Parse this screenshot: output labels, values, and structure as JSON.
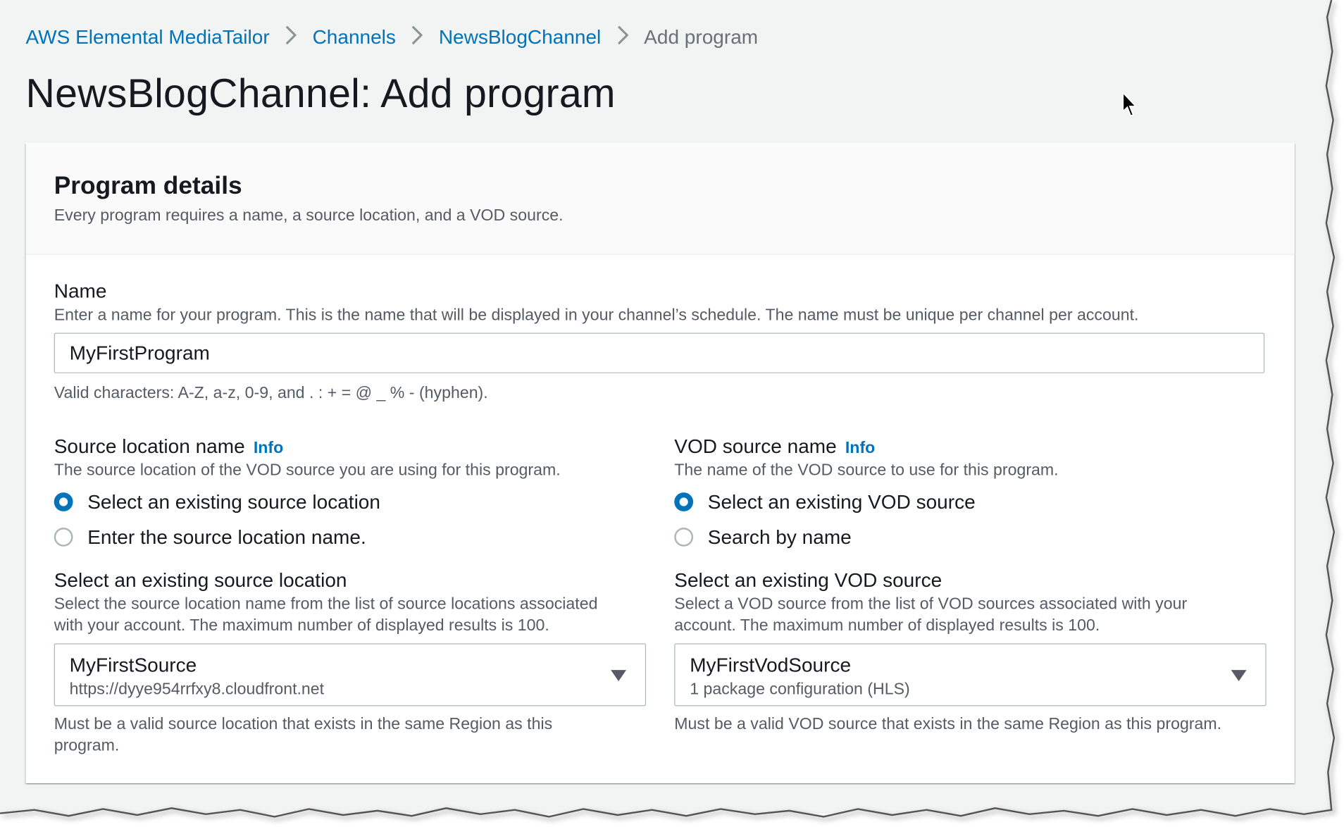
{
  "breadcrumb": {
    "items": [
      "AWS Elemental MediaTailor",
      "Channels",
      "NewsBlogChannel"
    ],
    "current": "Add program"
  },
  "page": {
    "title": "NewsBlogChannel: Add program"
  },
  "card": {
    "title": "Program details",
    "description": "Every program requires a name, a source location, and a VOD source."
  },
  "name_field": {
    "label": "Name",
    "description": "Enter a name for your program. This is the name that will be displayed in your channel’s schedule. The name must be unique per channel per account.",
    "value": "MyFirstProgram",
    "constraint": "Valid characters: A-Z, a-z, 0-9, and . : + = @ _ % - (hyphen)."
  },
  "source_location": {
    "label": "Source location name",
    "info": "Info",
    "description": "The source location of the VOD source you are using for this program.",
    "options": [
      "Select an existing source location",
      "Enter the source location name."
    ],
    "selected_option": "Select an existing source location",
    "select_label": "Select an existing source location",
    "select_description_line1": "Select the source location name from the list of source locations associated",
    "select_description_line2": "with your account. The maximum number of displayed results is 100.",
    "selected_value": "MyFirstSource",
    "selected_detail": "https://dyye954rrfxy8.cloudfront.net",
    "constraint_line1": "Must be a valid source location that exists in the same Region as this",
    "constraint_line2": "program."
  },
  "vod_source": {
    "label": "VOD source name",
    "info": "Info",
    "description": "The name of the VOD source to use for this program.",
    "options": [
      "Select an existing VOD source",
      "Search by name"
    ],
    "selected_option": "Select an existing VOD source",
    "select_label": "Select an existing VOD source",
    "select_description_line1": "Select a VOD source from the list of VOD sources associated with your",
    "select_description_line2": "account. The maximum number of displayed results is 100.",
    "selected_value": "MyFirstVodSource",
    "selected_detail": "1 package configuration (HLS)",
    "constraint": "Must be a valid VOD source that exists in the same Region as this program."
  },
  "colors": {
    "link": "#0073bb",
    "background": "#f2f3f3",
    "text": "#16191f",
    "secondary_text": "#545b64"
  },
  "icons": [
    "chevron-right-icon",
    "radio-checked-icon",
    "radio-unchecked-icon",
    "caret-down-icon",
    "mouse-cursor-icon"
  ]
}
